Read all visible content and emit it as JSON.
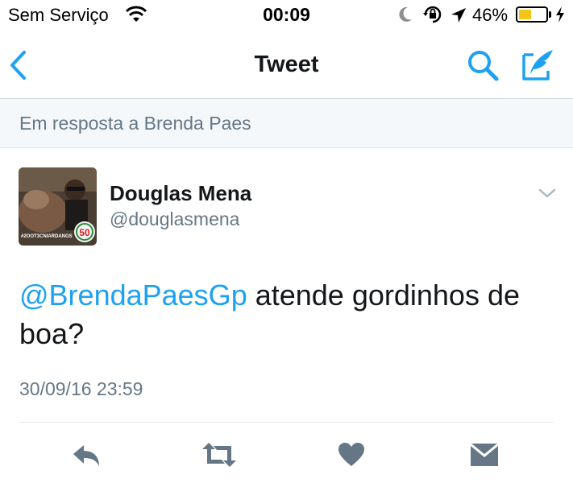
{
  "status_bar": {
    "carrier": "Sem Serviço",
    "time": "00:09",
    "battery_percent": "46%",
    "battery_level": 0.46,
    "icons": [
      "wifi-icon",
      "moon-icon",
      "rotation-lock-icon",
      "location-arrow-icon",
      "battery-icon",
      "charging-bolt-icon"
    ]
  },
  "nav": {
    "title": "Tweet",
    "icons": [
      "back-chevron-icon",
      "search-icon",
      "compose-tweet-icon"
    ]
  },
  "reply_banner": {
    "text": "Em resposta a Brenda Paes"
  },
  "tweet": {
    "author_name": "Douglas Mena",
    "author_handle": "@douglasmena",
    "mention": "@BrendaPaesGp",
    "text": " atende gordinhos de boa?",
    "timestamp": "30/09/16 23:59",
    "avatar": {
      "badge_text": "#2OOT3CNIARDANGS",
      "badge_number": "50"
    }
  },
  "actions": [
    "reply-icon",
    "retweet-icon",
    "like-icon",
    "direct-message-icon"
  ],
  "colors": {
    "accent": "#1da1f2",
    "text": "#14171a",
    "secondary_text": "#657786",
    "action_icon": "#657786",
    "battery_fill": "#f5c518"
  }
}
